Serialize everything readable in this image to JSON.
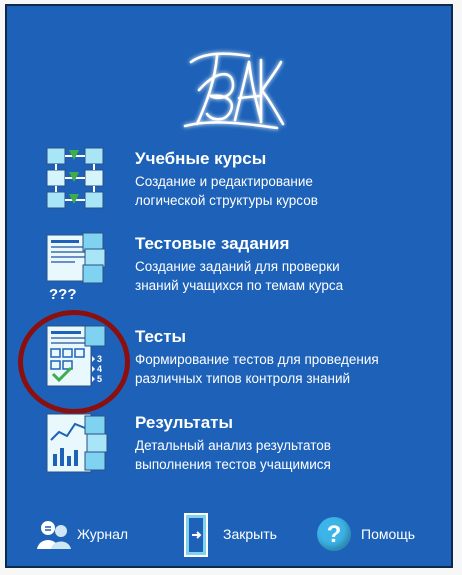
{
  "logo": {
    "name": "tvak-logo",
    "text": "ТВАК"
  },
  "menu": [
    {
      "title": "Учебные курсы",
      "desc_line1": "Создание и редактирование",
      "desc_line2": "логической структуры курсов",
      "icon": "course-structure-icon"
    },
    {
      "title": "Тестовые задания",
      "desc_line1": "Создание заданий для проверки",
      "desc_line2": "знаний учащихся по темам курса",
      "icon": "test-tasks-icon"
    },
    {
      "title": "Тесты",
      "desc_line1": "Формирование тестов для проведения",
      "desc_line2": "различных типов контроля знаний",
      "icon": "tests-icon"
    },
    {
      "title": "Результаты",
      "desc_line1": "Детальный анализ результатов",
      "desc_line2": "выполнения тестов учащимися",
      "icon": "results-chart-icon"
    }
  ],
  "footer": {
    "journal_label": "Журнал",
    "close_label": "Закрыть",
    "help_label": "Помощь",
    "help_glyph": "?"
  },
  "icon_glyphs": {
    "question_marks": "???",
    "list_3": "3",
    "list_4": "4",
    "list_5": "5"
  },
  "colors": {
    "background": "#1d62b8",
    "border": "#0b2a4c",
    "text": "#ffffff",
    "icon_accent": "#7fd3f0",
    "icon_green": "#3fae4a",
    "highlight": "#8a0f0f"
  }
}
